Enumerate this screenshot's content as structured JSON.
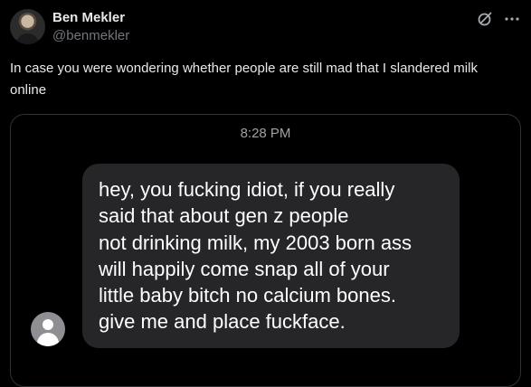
{
  "author": {
    "name": "Ben Mekler",
    "handle": "@benmekler"
  },
  "header_icons": [
    "grok-icon",
    "more-icon"
  ],
  "tweet": {
    "text": "In case you were wondering whether people are still mad that I slandered milk online"
  },
  "media": {
    "time": "8:28 PM",
    "message_lines": [
      "hey, you fucking idiot, if you really",
      "said that about gen z people",
      "not drinking milk, my 2003 born ass",
      "will happily come snap all of your",
      "little baby bitch no calcium bones.",
      "give me and place fuckface."
    ]
  },
  "colors": {
    "background": "#000000",
    "text_primary": "#e7e9ea",
    "text_secondary": "#71767b",
    "bubble": "#262629",
    "border": "#2f3336"
  }
}
